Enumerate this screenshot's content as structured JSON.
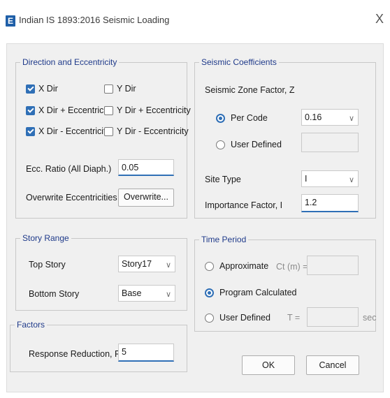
{
  "window": {
    "title": "Indian IS 1893:2016 Seismic Loading",
    "app_icon_letter": "E",
    "close_glyph": "X"
  },
  "direction": {
    "legend": "Direction and Eccentricity",
    "checkboxes": [
      {
        "label": "X Dir",
        "checked": true
      },
      {
        "label": "Y Dir",
        "checked": false
      },
      {
        "label": "X Dir + Eccentricity",
        "checked": true
      },
      {
        "label": "Y Dir + Eccentricity",
        "checked": false
      },
      {
        "label": "X Dir - Eccentricity",
        "checked": true
      },
      {
        "label": "Y Dir - Eccentricity",
        "checked": false
      }
    ],
    "ecc_ratio_label": "Ecc. Ratio (All Diaph.)",
    "ecc_ratio_value": "0.05",
    "overwrite_label": "Overwrite Eccentricities",
    "overwrite_button": "Overwrite..."
  },
  "seismic": {
    "legend": "Seismic Coefficients",
    "zone_label": "Seismic Zone Factor, Z",
    "per_code_label": "Per Code",
    "per_code_selected": true,
    "zone_value": "0.16",
    "user_defined_label": "User Defined",
    "user_defined_value": "",
    "site_type_label": "Site Type",
    "site_type_value": "I",
    "importance_label": "Importance Factor, I",
    "importance_value": "1.2"
  },
  "story": {
    "legend": "Story Range",
    "top_label": "Top Story",
    "top_value": "Story17",
    "bottom_label": "Bottom Story",
    "bottom_value": "Base"
  },
  "time_period": {
    "legend": "Time Period",
    "approximate_label": "Approximate",
    "ct_label": "Ct (m) =",
    "ct_value": "",
    "program_label": "Program Calculated",
    "program_selected": true,
    "user_defined_label": "User Defined",
    "t_label": "T =",
    "t_value": "",
    "sec_label": "sec"
  },
  "factors": {
    "legend": "Factors",
    "response_label": "Response Reduction, R",
    "response_value": "5"
  },
  "buttons": {
    "ok": "OK",
    "cancel": "Cancel"
  },
  "icons": {
    "dropdown": "chevron-down-icon",
    "close": "close-icon"
  }
}
